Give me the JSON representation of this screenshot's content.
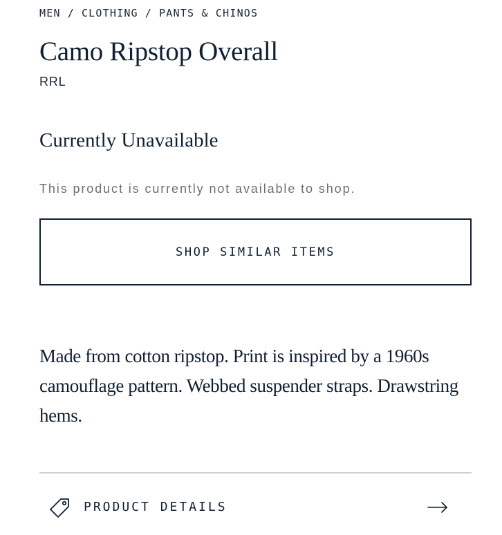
{
  "breadcrumb": {
    "items": [
      "MEN",
      "CLOTHING",
      "PANTS & CHINOS"
    ],
    "separator": "/"
  },
  "product": {
    "title": "Camo Ripstop Overall",
    "brand": "RRL",
    "description": "Made from cotton ripstop. Print is inspired by a 1960s camouflage pattern. Webbed suspender straps. Draw­string hems."
  },
  "availability": {
    "heading": "Currently Unavailable",
    "message": "This product is currently not available to shop."
  },
  "actions": {
    "shop_similar_label": "SHOP SIMILAR ITEMS"
  },
  "accordion": {
    "product_details_label": "PRODUCT DETAILS",
    "icon": "tag-icon",
    "chevron_icon": "arrow-right-icon"
  },
  "colors": {
    "text_primary": "#0f1f35",
    "text_muted": "#6f6f6f",
    "divider": "#cfcfcf",
    "background": "#ffffff"
  }
}
